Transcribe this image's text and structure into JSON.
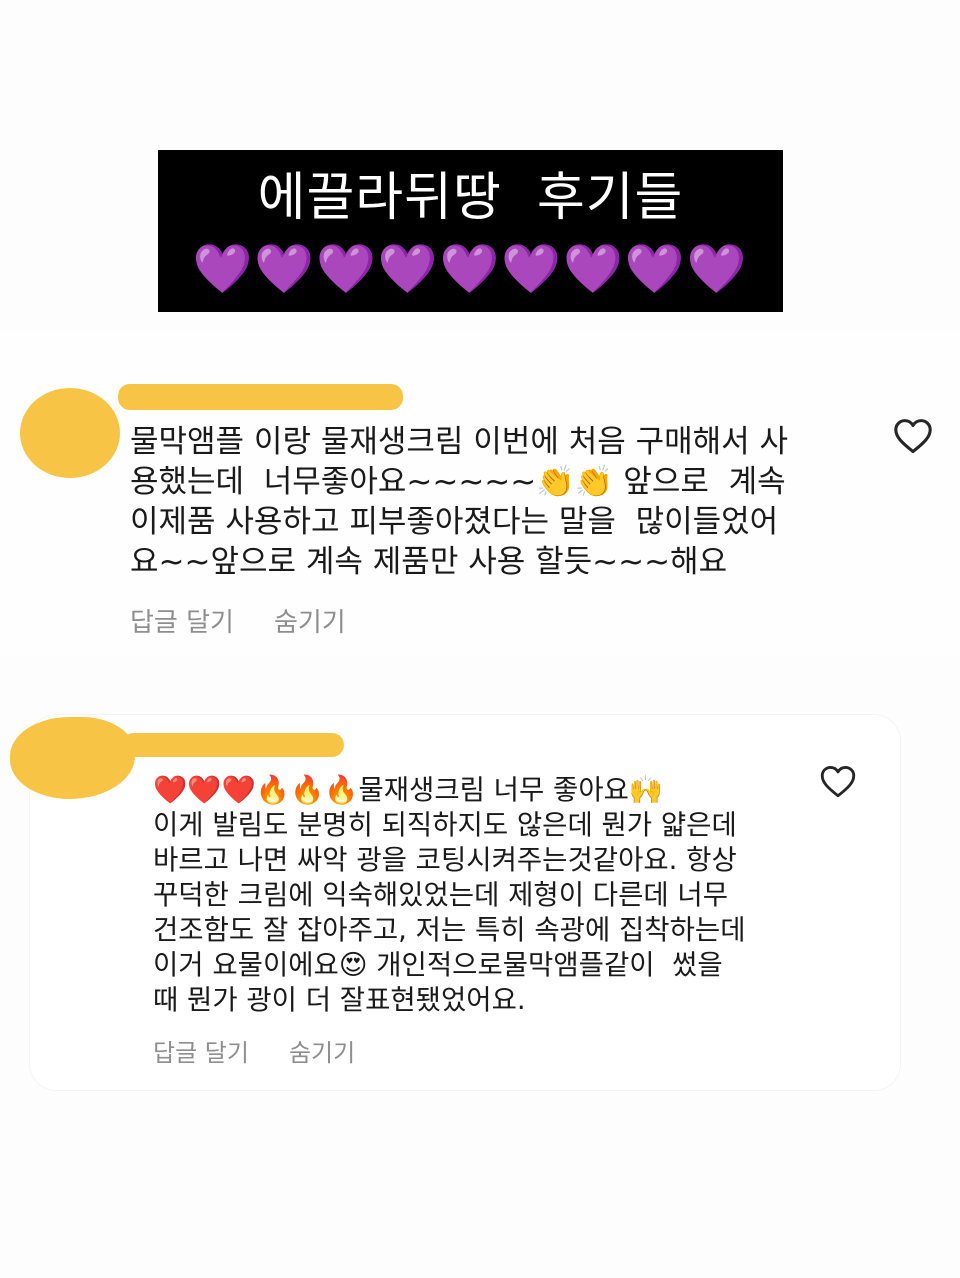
{
  "banner": {
    "title": "에끌라뒤땅  후기들",
    "hearts": "💜💜💜💜💜💜💜💜💜"
  },
  "colors": {
    "banner_bg": "#000000",
    "redaction": "#f8c445",
    "heart_icon": "#262626",
    "action_text": "#8e8e8e"
  },
  "comments": [
    {
      "lines": [
        "물막앰플 이랑 물재생크림 이번에 처음 구매해서 사",
        "용했는데  너무좋아요~~~~~👏👏 앞으로  계속",
        "이제품 사용하고 피부좋아졌다는 말을  많이들었어",
        "요~~앞으로 계속 제품만 사용 할듯~~~해요"
      ],
      "reply_label": "답글 달기",
      "hide_label": "숨기기",
      "like_icon": "heart-outline-icon"
    },
    {
      "lines": [
        "❤️❤️❤️🔥🔥🔥물재생크림 너무 좋아요🙌",
        "이게 발림도 분명히 되직하지도 않은데 뭔가 얇은데",
        "바르고 나면 싸악 광을 코팅시켜주는것같아요. 항상",
        "꾸덕한 크림에 익숙해있었는데 제형이 다른데 너무",
        "건조함도 잘 잡아주고, 저는 특히 속광에 집착하는데",
        "이거 요물이에요😍 개인적으로물막앰플같이  썼을",
        "때 뭔가 광이 더 잘표현됐었어요."
      ],
      "reply_label": "답글 달기",
      "hide_label": "숨기기",
      "like_icon": "heart-outline-icon"
    }
  ]
}
